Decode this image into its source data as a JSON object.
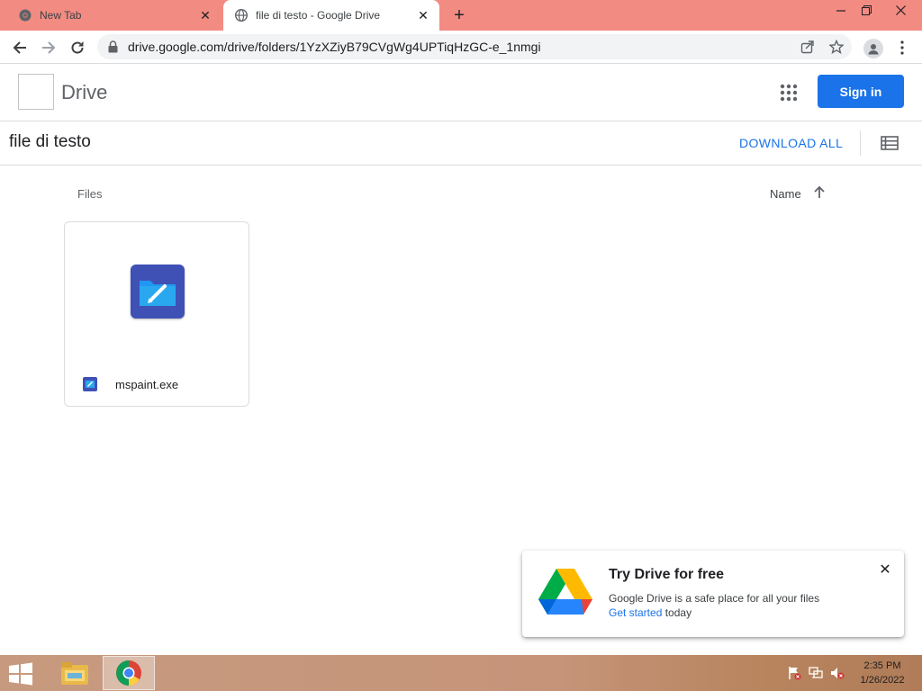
{
  "browser": {
    "tabs": [
      {
        "title": "New Tab",
        "active": false
      },
      {
        "title": "file di testo - Google Drive",
        "active": true
      }
    ],
    "url": "drive.google.com/drive/folders/1YzXZiyB79CVgWg4UPTiqHzGC-e_1nmgi"
  },
  "header": {
    "brand": "Drive",
    "signin_label": "Sign in"
  },
  "folder": {
    "title": "file di testo",
    "download_all_label": "DOWNLOAD ALL"
  },
  "files_section": {
    "label": "Files",
    "sort_label": "Name"
  },
  "files": [
    {
      "name": "mspaint.exe"
    }
  ],
  "promo": {
    "title": "Try Drive for free",
    "body": "Google Drive is a safe place for all your files",
    "link": "Get started",
    "link_suffix": " today"
  },
  "taskbar": {
    "time": "2:35 PM",
    "date": "1/26/2022"
  },
  "colors": {
    "tabstrip": "#f28b82",
    "accent": "#1a73e8",
    "file_icon": "#3f51b5"
  }
}
